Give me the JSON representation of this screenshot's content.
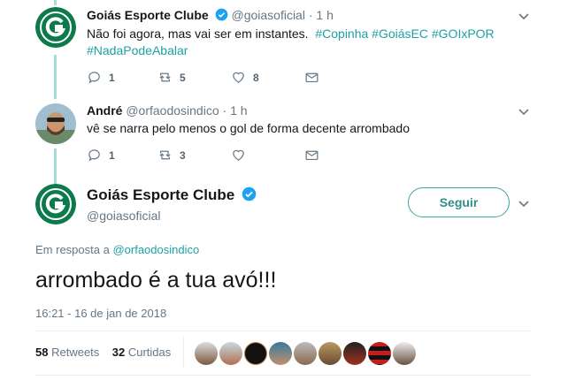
{
  "colors": {
    "brand": "#0d7a4c",
    "accent": "#1da1a4",
    "thread": "#a8dcd4",
    "muted": "#657786"
  },
  "tweet1": {
    "name": "Goiás Esporte Clube",
    "handle": "@goiasoficial",
    "time": "· 1 h",
    "text": "Não foi agora, mas vai ser em instantes.",
    "hashtags": [
      "#Copinha",
      "#GoiásEC",
      "#GOIxPOR",
      "#NadaPodeAbalar"
    ],
    "replies": "1",
    "retweets": "5",
    "likes": "8"
  },
  "tweet2": {
    "name": "André",
    "handle": "@orfaodosindico",
    "time": "· 1 h",
    "text": "vê se narra pelo menos o gol de forma decente arrombado",
    "replies": "1",
    "retweets": "3",
    "likes": ""
  },
  "main": {
    "name": "Goiás Esporte Clube",
    "handle": "@goiasoficial",
    "follow_label": "Seguir",
    "reply_prefix": "Em resposta a",
    "reply_to": "@orfaodosindico",
    "text": "arrombado é a tua avó!!!",
    "timestamp": "16:21 - 16 de jan de 2018",
    "retweets_count": "58",
    "retweets_label": "Retweets",
    "likes_count": "32",
    "likes_label": "Curtidas"
  },
  "icons": [
    "verified-icon",
    "chevron-down-icon",
    "reply-icon",
    "retweet-icon",
    "heart-icon",
    "envelope-icon",
    "goias-logo"
  ]
}
